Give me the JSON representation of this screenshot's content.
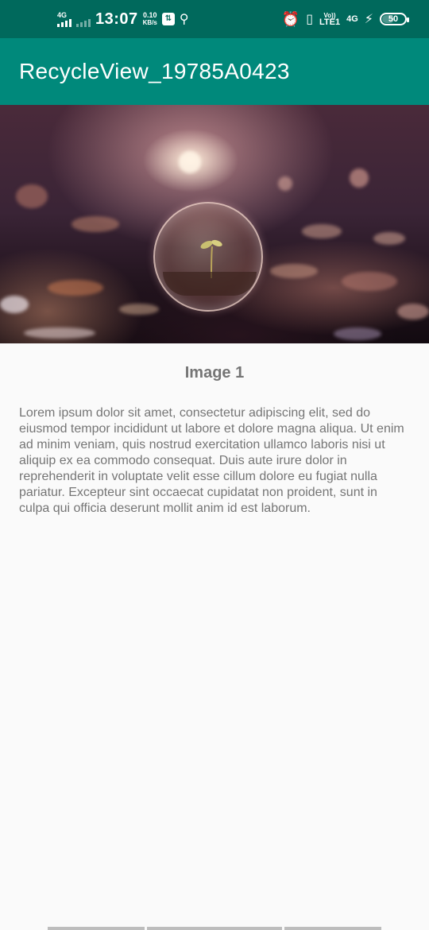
{
  "status_bar": {
    "network_label": "4G",
    "time": "13:07",
    "speed_value": "0.10",
    "speed_unit": "KB/s",
    "volte_label": "Vo))",
    "lte_label": "LTE1",
    "network2_label": "4G",
    "battery_level": "50"
  },
  "app_bar": {
    "title": "RecycleView_19785A0423"
  },
  "item": {
    "title": "Image 1",
    "description": "Lorem ipsum dolor sit amet, consectetur adipiscing elit, sed do eiusmod tempor incididunt ut labore et dolore magna aliqua. Ut enim ad minim veniam, quis nostrud exercitation ullamco laboris nisi ut aliquip ex ea commodo consequat. Duis aute irure dolor in reprehenderit in voluptate velit esse cillum dolore eu fugiat nulla pariatur. Excepteur sint occaecat cupidatat non proident, sunt in culpa qui officia deserunt mollit anim id est laborum."
  },
  "colors": {
    "status_bar": "#00695c",
    "app_bar": "#00897b",
    "background": "#fafafa",
    "text": "#757575"
  }
}
